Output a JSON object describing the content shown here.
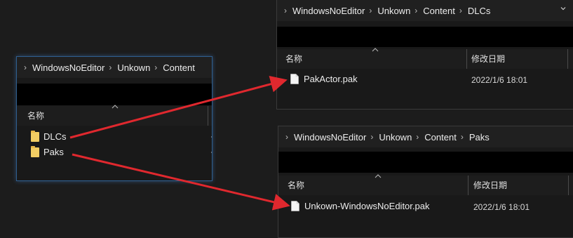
{
  "win_left": {
    "crumbs": [
      "WindowsNoEditor",
      "Unkown",
      "Content"
    ],
    "col_name": "名称",
    "items": [
      "DLCs",
      "Paks"
    ]
  },
  "win_dlcs": {
    "crumbs": [
      "WindowsNoEditor",
      "Unkown",
      "Content",
      "DLCs"
    ],
    "col_name": "名称",
    "col_date": "修改日期",
    "file_name": "PakActor.pak",
    "file_date": "2022/1/6 18:01"
  },
  "win_paks": {
    "crumbs": [
      "WindowsNoEditor",
      "Unkown",
      "Content",
      "Paks"
    ],
    "col_name": "名称",
    "col_date": "修改日期",
    "file_name": "Unkown-WindowsNoEditor.pak",
    "file_date": "2022/1/6 18:01"
  },
  "colors": {
    "arrow": "#e0282e",
    "folder": "#f2cd63",
    "focus_border": "#2f5f8f"
  }
}
